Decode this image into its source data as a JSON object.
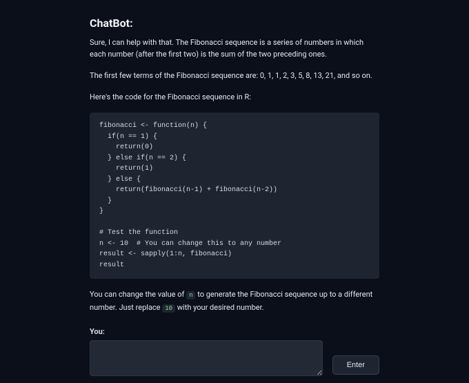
{
  "bot": {
    "name_label": "ChatBot:",
    "paragraphs": {
      "p1": "Sure, I can help with that. The Fibonacci sequence is a series of numbers in which each number (after the first two) is the sum of the two preceding ones.",
      "p2": "The first few terms of the Fibonacci sequence are: 0, 1, 1, 2, 3, 5, 8, 13, 21, and so on.",
      "p3": "Here's the code for the Fibonacci sequence in R:"
    },
    "code": "fibonacci <- function(n) {\n  if(n == 1) {\n    return(0)\n  } else if(n == 2) {\n    return(1)\n  } else {\n    return(fibonacci(n-1) + fibonacci(n-2))\n  }\n}\n\n# Test the function\nn <- 10  # You can change this to any number\nresult <- sapply(1:n, fibonacci)\nresult",
    "p4_parts": {
      "a": "You can change the value of ",
      "code_n": "n",
      "b": " to generate the Fibonacci sequence up to a different number. Just replace ",
      "code_10": "10",
      "c": " with your desired number."
    }
  },
  "user": {
    "label": "You:",
    "input_value": "",
    "placeholder": ""
  },
  "controls": {
    "enter_label": "Enter"
  }
}
